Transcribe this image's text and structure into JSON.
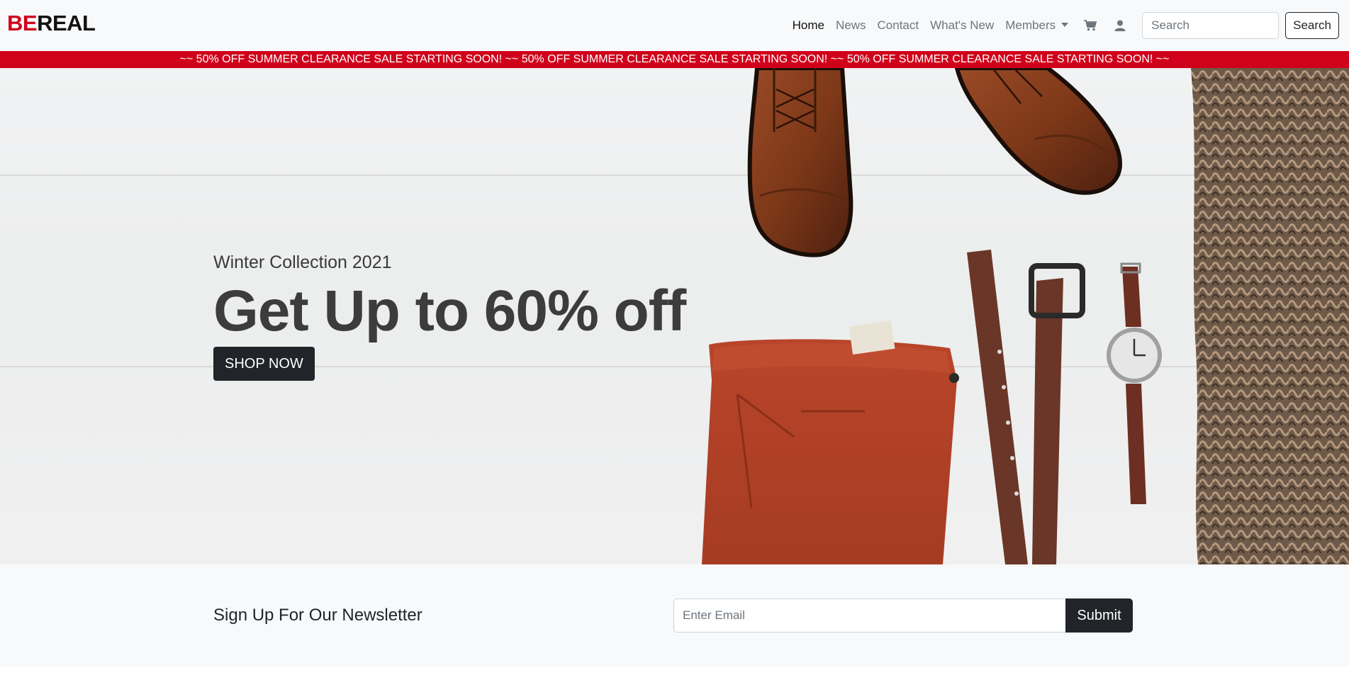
{
  "brand": {
    "part1": "BE",
    "part2": "REAL"
  },
  "nav": {
    "items": [
      {
        "label": "Home"
      },
      {
        "label": "News"
      },
      {
        "label": "Contact"
      },
      {
        "label": "What's New"
      },
      {
        "label": "Members"
      }
    ],
    "icons": [
      "cart-icon",
      "user-icon"
    ],
    "search_placeholder": "Search",
    "search_button": "Search"
  },
  "promo": {
    "text": "~~ 50% OFF SUMMER CLEARANCE SALE STARTING SOON! ~~ 50% OFF SUMMER CLEARANCE SALE STARTING SOON! ~~ 50% OFF SUMMER CLEARANCE SALE STARTING SOON! ~~"
  },
  "hero": {
    "subtitle": "Winter Collection 2021",
    "title": "Get Up to 60% off",
    "cta": "SHOP NOW"
  },
  "newsletter": {
    "title": "Sign Up For Our Newsletter",
    "placeholder": "Enter Email",
    "button": "Submit"
  },
  "colors": {
    "accent": "#d0021b",
    "dark": "#212529",
    "light": "#f8f9fa"
  }
}
